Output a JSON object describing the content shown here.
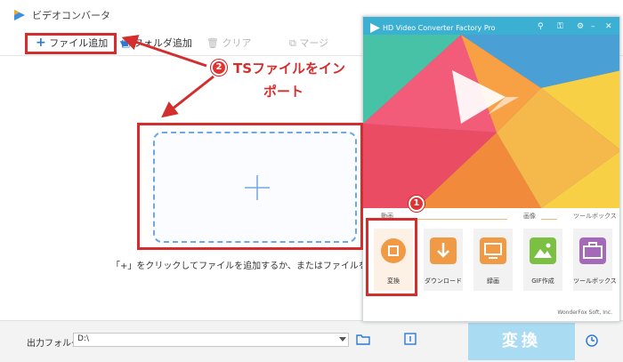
{
  "app": {
    "title": "ビデオコンバータ"
  },
  "toolbar": {
    "add_file": "ファイル追加",
    "add_folder": "フォルダ追加",
    "clear": "クリア",
    "merge": "マージ"
  },
  "main": {
    "drop_hint": "「+」をクリックしてファイルを追加するか、またはファイルをここまでドラ"
  },
  "bottom": {
    "output_label": "出力フォルダ：",
    "output_path": "D:\\",
    "convert_label": "変換"
  },
  "hd": {
    "title": "HD Video Converter Factory Pro",
    "categories": {
      "video": "動画",
      "image": "画像",
      "toolbox": "ツールボックス"
    },
    "tiles": [
      {
        "label": "変換",
        "icon": "film-icon",
        "color": "#f19a46"
      },
      {
        "label": "ダウンロード",
        "icon": "download-icon",
        "color": "#f19a46"
      },
      {
        "label": "録画",
        "icon": "screen-record-icon",
        "color": "#f19a46"
      },
      {
        "label": "GIF作成",
        "icon": "image-icon",
        "color": "#7bc043"
      },
      {
        "label": "ツールボックス",
        "icon": "toolbox-icon",
        "color": "#a46ab9"
      }
    ],
    "footer": "WonderFox Soft, Inc."
  },
  "annotations": {
    "step1": "1",
    "step2": "2",
    "step2_text_line1": "TSファイルをイン",
    "step2_text_line2": "ポート"
  },
  "colors": {
    "accent_red": "#d32d2d",
    "convert_button": "#a9dcf3",
    "drop_border": "#6ea7e6"
  }
}
